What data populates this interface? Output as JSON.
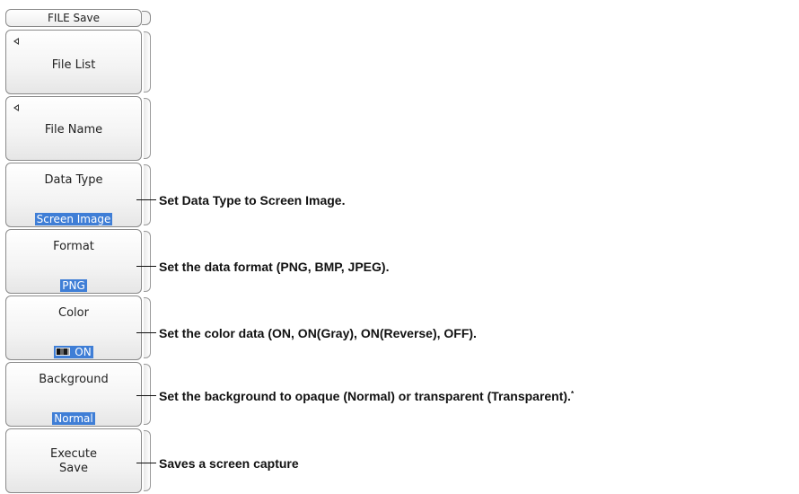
{
  "menu": {
    "title": "FILE Save",
    "softkeys": {
      "file_list": {
        "label": "File List"
      },
      "file_name": {
        "label": "File Name"
      },
      "data_type": {
        "label": "Data Type",
        "value": "Screen Image"
      },
      "format": {
        "label": "Format",
        "value": "PNG"
      },
      "color": {
        "label": "Color",
        "value": "ON",
        "icon": "color-palette-icon"
      },
      "background": {
        "label": "Background",
        "value": "Normal"
      },
      "execute": {
        "label_line1": "Execute",
        "label_line2": "Save"
      }
    }
  },
  "callouts": {
    "data_type": "Set Data Type to Screen Image.",
    "format": "Set the data format (PNG, BMP, JPEG).",
    "color": "Set the color data (ON, ON(Gray), ON(Reverse), OFF).",
    "background": "Set the background to opaque (Normal) or transparent (Transparent).",
    "background_note": "*",
    "execute": "Saves a screen capture"
  },
  "colors": {
    "selected_value_bg": "#3f7ed6",
    "softkey_border": "#8a8a8a",
    "text": "#222222"
  }
}
